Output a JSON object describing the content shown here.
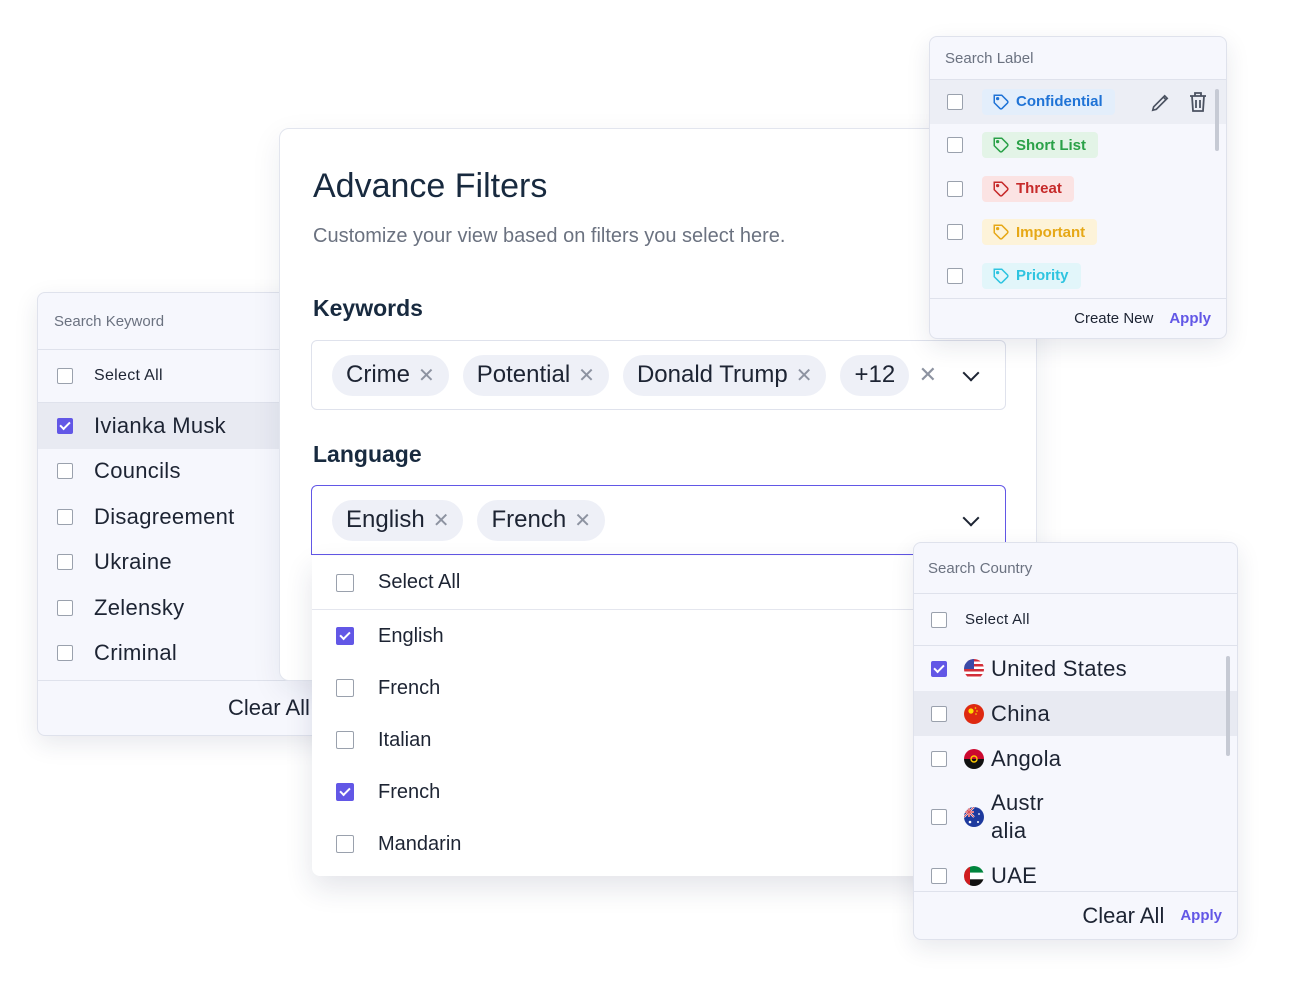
{
  "keyword_panel": {
    "search_placeholder": "Search Keyword",
    "select_all_label": "Select All",
    "items": [
      {
        "label": "Ivianka Musk",
        "checked": true
      },
      {
        "label": "Councils",
        "checked": false
      },
      {
        "label": "Disagreement",
        "checked": false
      },
      {
        "label": "Ukraine",
        "checked": false
      },
      {
        "label": "Zelensky",
        "checked": false
      },
      {
        "label": "Criminal",
        "checked": false
      }
    ],
    "clear_label": "Clear All"
  },
  "advance_filters": {
    "title": "Advance Filters",
    "subtitle": "Customize your view based on filters you select here.",
    "keywords": {
      "label": "Keywords",
      "chips": [
        "Crime",
        "Potential",
        "Donald Trump"
      ],
      "more_count": "+12"
    },
    "language": {
      "label": "Language",
      "chips": [
        "English",
        "French"
      ],
      "options_select_all": "Select All",
      "options": [
        {
          "label": "English",
          "checked": true
        },
        {
          "label": "French",
          "checked": false
        },
        {
          "label": "Italian",
          "checked": false
        },
        {
          "label": "French",
          "checked": true
        },
        {
          "label": "Mandarin",
          "checked": false
        }
      ]
    }
  },
  "label_panel": {
    "search_placeholder": "Search Label",
    "labels": [
      {
        "label": "Confidential",
        "color": "#1f73d6",
        "bg": "#e3eefb"
      },
      {
        "label": "Short List",
        "color": "#2aa148",
        "bg": "#e3f4e7"
      },
      {
        "label": "Threat",
        "color": "#c62a2a",
        "bg": "#fbe3e3"
      },
      {
        "label": "Important",
        "color": "#e6a817",
        "bg": "#fdf3d9"
      },
      {
        "label": "Priority",
        "color": "#2ec4e0",
        "bg": "#e2f6fa"
      }
    ],
    "create_label": "Create New",
    "apply_label": "Apply"
  },
  "country_panel": {
    "search_placeholder": "Search Country",
    "select_all_label": "Select All",
    "countries": [
      {
        "label": "United States",
        "checked": true,
        "flag": "us-flag-icon"
      },
      {
        "label": "China",
        "checked": false,
        "flag": "china-flag-icon"
      },
      {
        "label": "Angola",
        "checked": false,
        "flag": "angola-flag-icon"
      },
      {
        "label": "Austr\nalia",
        "checked": false,
        "flag": "australia-flag-icon"
      },
      {
        "label": "UAE",
        "checked": false,
        "flag": "uae-flag-icon"
      }
    ],
    "clear_label": "Clear All",
    "apply_label": "Apply"
  },
  "colors": {
    "accent": "#6257e6",
    "title": "#182a3f",
    "panel_bg": "#f6f7fd"
  }
}
